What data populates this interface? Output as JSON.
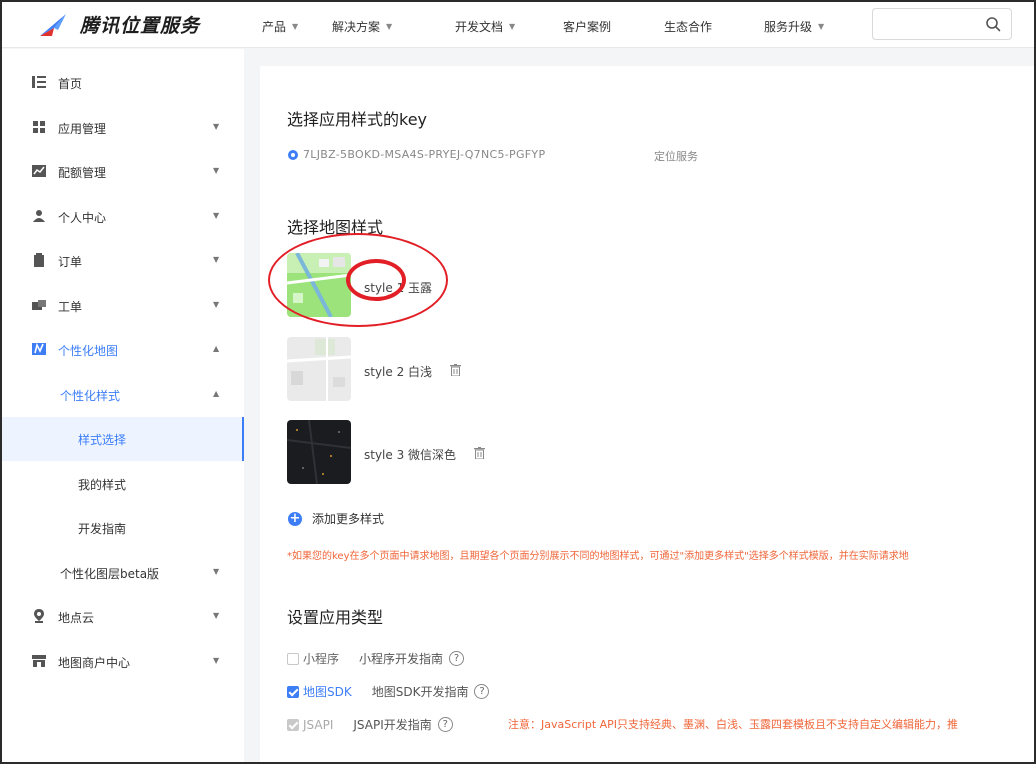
{
  "brand": {
    "name": "腾讯位置服务"
  },
  "nav": {
    "items": [
      {
        "label": "产品",
        "has_caret": true
      },
      {
        "label": "解决方案",
        "has_caret": true
      },
      {
        "label": "开发文档",
        "has_caret": true
      },
      {
        "label": "客户案例",
        "has_caret": false
      },
      {
        "label": "生态合作",
        "has_caret": false
      },
      {
        "label": "服务升级",
        "has_caret": true
      }
    ],
    "search": {
      "placeholder": "",
      "value": ""
    }
  },
  "sidebar": {
    "items": [
      {
        "label": "首页",
        "icon": "list-icon"
      },
      {
        "label": "应用管理",
        "icon": "grid-icon",
        "arrow": "▼"
      },
      {
        "label": "配额管理",
        "icon": "chart-icon",
        "arrow": "▼"
      },
      {
        "label": "个人中心",
        "icon": "user-icon",
        "arrow": "▼"
      },
      {
        "label": "订单",
        "icon": "clipboard-icon",
        "arrow": "▼"
      },
      {
        "label": "工单",
        "icon": "ticket-icon",
        "arrow": "▼"
      },
      {
        "label": "个性化地图",
        "icon": "custom-map-icon",
        "arrow": "▲"
      },
      {
        "label": "个性化样式",
        "arrow": "▲"
      },
      {
        "label": "样式选择"
      },
      {
        "label": "我的样式"
      },
      {
        "label": "开发指南"
      },
      {
        "label": "个性化图层beta版",
        "arrow": "▼"
      },
      {
        "label": "地点云",
        "icon": "location-pin-icon",
        "arrow": "▼"
      },
      {
        "label": "地图商户中心",
        "icon": "store-icon",
        "arrow": "▼"
      }
    ]
  },
  "main": {
    "key_section": {
      "title": "选择应用样式的key",
      "key": "7LJBZ-5BOKD-MSA4S-PRYEJ-Q7NC5-PGFYP",
      "service": "定位服务"
    },
    "style_section": {
      "title": "选择地图样式",
      "styles": [
        {
          "label": "style 1 玉露",
          "theme": "green"
        },
        {
          "label": "style 2 白浅",
          "theme": "light"
        },
        {
          "label": "style 3 微信深色",
          "theme": "dark"
        }
      ],
      "add_label": "添加更多样式",
      "notice": "*如果您的key在多个页面中请求地图，且期望各个页面分别展示不同的地图样式，可通过\"添加更多样式\"选择多个样式模版，并在实际请求地"
    },
    "app_type_section": {
      "title": "设置应用类型",
      "options": [
        {
          "label": "小程序",
          "guide": "小程序开发指南",
          "state": "unchecked"
        },
        {
          "label": "地图SDK",
          "guide": "地图SDK开发指南",
          "state": "checked"
        },
        {
          "label": "JSAPI",
          "guide": "JSAPI开发指南",
          "state": "disabled"
        }
      ],
      "jsapi_note": "注意：JavaScript API只支持经典、墨渊、白浅、玉露四套模板且不支持自定义编辑能力，推"
    }
  },
  "colors": {
    "accent": "#3d7ef7",
    "warning": "#f0663a",
    "annotation": "#e21f26"
  }
}
